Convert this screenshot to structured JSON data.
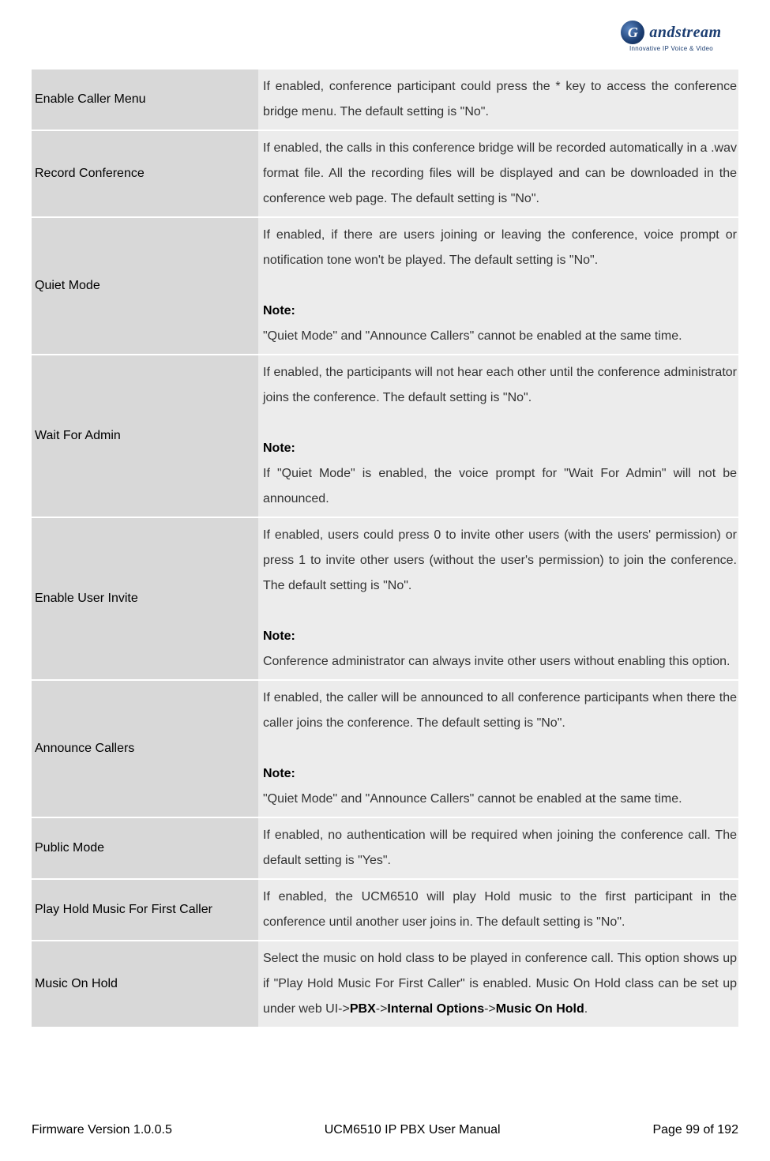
{
  "logo": {
    "brand": "andstream",
    "g": "G",
    "tagline": "Innovative IP Voice & Video"
  },
  "rows": [
    {
      "label": "Enable Caller Menu",
      "desc_p1": "If enabled, conference participant could press the * key to access the conference bridge menu. The default setting is \"No\"."
    },
    {
      "label": "Record Conference",
      "desc_p1": "If enabled, the calls in this conference bridge will be recorded automatically in a .wav format file. All the recording files will be displayed and can be downloaded in the conference web page. The default setting is \"No\"."
    },
    {
      "label": "Quiet Mode",
      "desc_p1": "If enabled, if there are users joining or leaving the conference, voice prompt or notification tone won't be played. The default setting is \"No\".",
      "note_label": "Note:",
      "note_text": "\"Quiet Mode\" and \"Announce Callers\" cannot be enabled at the same time."
    },
    {
      "label": "Wait For Admin",
      "desc_p1": "If enabled, the participants will not hear each other until the conference administrator joins the conference. The default setting is \"No\".",
      "note_label": "Note:",
      "note_text": "If \"Quiet Mode\" is enabled, the voice prompt for \"Wait For Admin\" will not be announced."
    },
    {
      "label": "Enable User Invite",
      "desc_p1": "If enabled, users could press 0 to invite other users (with the users' permission) or press 1 to invite other users (without the user's permission)  to join the conference. The default setting is \"No\".",
      "note_label": "Note:",
      "note_text": "Conference administrator can always invite other users without enabling this option."
    },
    {
      "label": "Announce Callers",
      "desc_p1": "If enabled, the caller will be announced to all conference participants when there the caller joins the conference. The default setting is \"No\".",
      "note_label": "Note:",
      "note_text": "\"Quiet Mode\" and \"Announce Callers\" cannot be enabled at the same time."
    },
    {
      "label": "Public Mode",
      "desc_p1": "If enabled, no authentication will be required when joining the conference call. The default setting is \"Yes\"."
    },
    {
      "label": "Play Hold Music For First Caller",
      "desc_p1": "If enabled, the UCM6510 will play Hold music to the first participant in the conference until another user joins in. The default setting is \"No\"."
    },
    {
      "label": "Music On Hold",
      "moh_pre": "Select the music on hold class to be played in conference call. This option shows up if \"Play Hold Music For First Caller\" is enabled. Music On Hold class can be set up under web UI->",
      "moh_b1": "PBX",
      "moh_sep1": "->",
      "moh_b2": "Internal Options",
      "moh_sep2": "->",
      "moh_b3": "Music On Hold",
      "moh_post": "."
    }
  ],
  "footer": {
    "left": "Firmware Version 1.0.0.5",
    "center": "UCM6510 IP PBX User Manual",
    "right": "Page 99 of 192"
  }
}
